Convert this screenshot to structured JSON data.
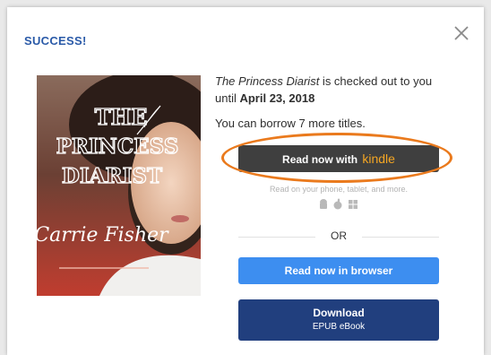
{
  "modal": {
    "title": "SUCCESS!",
    "close_icon": "close-icon"
  },
  "book": {
    "cover_title_lines": [
      "THE",
      "PRINCESS",
      "DIARIST"
    ],
    "cover_author": "Carrie Fisher"
  },
  "checkout": {
    "book_title": "The Princess Diarist",
    "checked_out_text": " is checked out to you",
    "until_text": "until ",
    "due_date": "April 23, 2018",
    "borrow_text": "You can borrow 7 more titles."
  },
  "actions": {
    "kindle_prefix": "Read now with ",
    "kindle_word": "kindle",
    "devices_text": "Read on your phone, tablet, and more.",
    "device_icons": [
      "android-icon",
      "apple-icon",
      "windows-icon"
    ],
    "or_label": "OR",
    "browser_label": "Read now in browser",
    "download_label": "Download",
    "download_sub": "EPUB eBook"
  },
  "colors": {
    "title_blue": "#2a5aa8",
    "kindle_button": "#3f3f3f",
    "kindle_accent": "#f5a623",
    "highlight_oval": "#ea7a1d",
    "browser_button": "#3d8ef0",
    "download_button": "#213f7e"
  }
}
